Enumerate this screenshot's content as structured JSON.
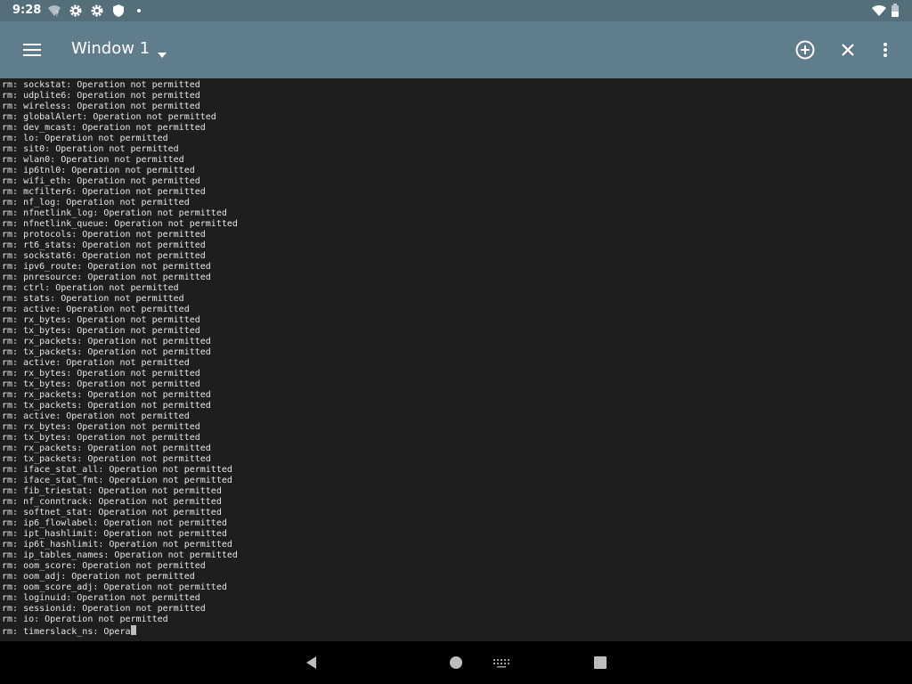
{
  "status_bar": {
    "time": "9:28",
    "icons_left": [
      "wifi-question-icon",
      "gear-icon",
      "gear-icon",
      "shield-icon",
      "dot-icon"
    ],
    "icons_right": [
      "wifi-icon",
      "battery-icon"
    ]
  },
  "toolbar": {
    "menu_icon": "hamburger-menu-icon",
    "window_title": "Window 1",
    "dropdown_icon": "caret-down-icon",
    "add_icon": "add-circle-icon",
    "close_icon": "close-icon",
    "more_icon": "more-vert-icon",
    "background": "#607d8b"
  },
  "terminal": {
    "background": "#1e1e1e",
    "text_color": "#e6e6e6",
    "lines": [
      "rm: sockstat: Operation not permitted",
      "rm: udplite6: Operation not permitted",
      "rm: wireless: Operation not permitted",
      "rm: globalAlert: Operation not permitted",
      "rm: dev_mcast: Operation not permitted",
      "rm: lo: Operation not permitted",
      "rm: sit0: Operation not permitted",
      "rm: wlan0: Operation not permitted",
      "rm: ip6tnl0: Operation not permitted",
      "rm: wifi_eth: Operation not permitted",
      "rm: mcfilter6: Operation not permitted",
      "rm: nf_log: Operation not permitted",
      "rm: nfnetlink_log: Operation not permitted",
      "rm: nfnetlink_queue: Operation not permitted",
      "rm: protocols: Operation not permitted",
      "rm: rt6_stats: Operation not permitted",
      "rm: sockstat6: Operation not permitted",
      "rm: ipv6_route: Operation not permitted",
      "rm: pnresource: Operation not permitted",
      "rm: ctrl: Operation not permitted",
      "rm: stats: Operation not permitted",
      "rm: active: Operation not permitted",
      "rm: rx_bytes: Operation not permitted",
      "rm: tx_bytes: Operation not permitted",
      "rm: rx_packets: Operation not permitted",
      "rm: tx_packets: Operation not permitted",
      "rm: active: Operation not permitted",
      "rm: rx_bytes: Operation not permitted",
      "rm: tx_bytes: Operation not permitted",
      "rm: rx_packets: Operation not permitted",
      "rm: tx_packets: Operation not permitted",
      "rm: active: Operation not permitted",
      "rm: rx_bytes: Operation not permitted",
      "rm: tx_bytes: Operation not permitted",
      "rm: rx_packets: Operation not permitted",
      "rm: tx_packets: Operation not permitted",
      "rm: iface_stat_all: Operation not permitted",
      "rm: iface_stat_fmt: Operation not permitted",
      "rm: fib_triestat: Operation not permitted",
      "rm: nf_conntrack: Operation not permitted",
      "rm: softnet_stat: Operation not permitted",
      "rm: ip6_flowlabel: Operation not permitted",
      "rm: ipt_hashlimit: Operation not permitted",
      "rm: ip6t_hashlimit: Operation not permitted",
      "rm: ip_tables_names: Operation not permitted",
      "rm: oom_score: Operation not permitted",
      "rm: oom_adj: Operation not permitted",
      "rm: oom_score_adj: Operation not permitted",
      "rm: loginuid: Operation not permitted",
      "rm: sessionid: Operation not permitted",
      "rm: io: Operation not permitted"
    ],
    "current_line": "rm: timerslack_ns: Opera"
  },
  "nav_bar": {
    "icons": [
      "back-icon",
      "home-icon",
      "keyboard-icon",
      "recents-icon"
    ]
  }
}
